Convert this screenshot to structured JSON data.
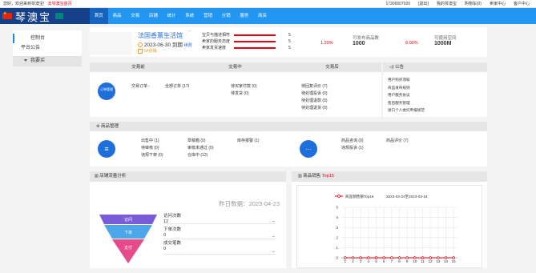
{
  "topbar": {
    "welcome": "您好，欢迎来到琴澳宝!",
    "store_link": "去琴澳宝首页",
    "phone": "17306507020",
    "exit": "[退出]",
    "my_store": "我的琴澳宝",
    "cart": "购物车(0)",
    "seller_center": "卖家中心",
    "service_center": "客户中心"
  },
  "brand": {
    "name": "琴澳宝"
  },
  "nav": [
    "首页",
    "商品",
    "交易",
    "店铺",
    "统计",
    "系统",
    "营销",
    "分销",
    "服务",
    "商店"
  ],
  "sidebar": {
    "items": [
      "控制台",
      "平台公告"
    ],
    "section": "我要买"
  },
  "store": {
    "name": "法国香薰生活馆",
    "date": "2023-06-30 到期",
    "level": "5A店铺",
    "renew": "续费",
    "dash": "-",
    "ratings": [
      {
        "label": "宝贝与描述相符",
        "value": "5"
      },
      {
        "label": "卖家的服务态度",
        "value": "5"
      },
      {
        "label": "卖家发货速度",
        "value": "5"
      }
    ],
    "rate": "1.20%",
    "publish_label": "可发布商品数",
    "publish_value": "1000",
    "pct2": "0.00%",
    "space_label": "可使用空间",
    "space_value": "1000M"
  },
  "trade": {
    "cols": [
      "交易前",
      "交易中",
      "交易后"
    ],
    "icon_label": "订单管理",
    "pre": [
      "交易订单 -",
      "全部订单 (17)"
    ],
    "mid": [
      "待买家付款 (0)",
      "待发货 (0)"
    ],
    "post": [
      "待回复评价 (7)",
      "待处理投诉 (0)",
      "待处理退款 (0)",
      "待处理退货 (0)"
    ]
  },
  "notice": {
    "title": "公告",
    "items": [
      "用户购买须知",
      "商品发布规则",
      "用户服务协议",
      "售后服务管理",
      "浙口个人委托申报规范"
    ]
  },
  "goods": {
    "title": "商品管理",
    "a": [
      "出售中 (1)",
      "待审核 (0)",
      "违规下架 (0)"
    ],
    "b": [
      "草稿箱 (0)",
      "审核未通过 (0)",
      "仓库中 (12)"
    ],
    "c": "库存报警 (1)",
    "d": [
      "商品咨询 (0)",
      "违规投诉 (1)"
    ],
    "e": "商品评价 (7)"
  },
  "funnel": {
    "title": "店铺流量分析",
    "date": "昨日数据：2023-04-23",
    "stages": [
      "访问",
      "下单",
      "支付"
    ],
    "rows": [
      {
        "label": "访问次数",
        "value": "12",
        "dash": "–"
      },
      {
        "label": "下单次数",
        "value": "0",
        "dash": "–"
      },
      {
        "label": "成交笔数",
        "value": "0",
        "dash": "–"
      }
    ]
  },
  "sales": {
    "title": "商品销售",
    "highlight": "Top15"
  },
  "chart_data": {
    "type": "line",
    "legend": "商品销售额Top15",
    "subtitle": "2023-03-24至2023-04-24",
    "x": [
      1,
      2,
      3,
      4,
      5,
      6,
      7,
      8,
      9,
      10,
      11,
      12,
      13,
      14,
      15
    ],
    "y": [
      0,
      0,
      0,
      0,
      0,
      0,
      0,
      0,
      0,
      0,
      0,
      0,
      0,
      0,
      0
    ],
    "ylim": [
      0,
      5
    ],
    "yticks": [
      0,
      1,
      2,
      3,
      4,
      5
    ],
    "color": "#e60012"
  }
}
